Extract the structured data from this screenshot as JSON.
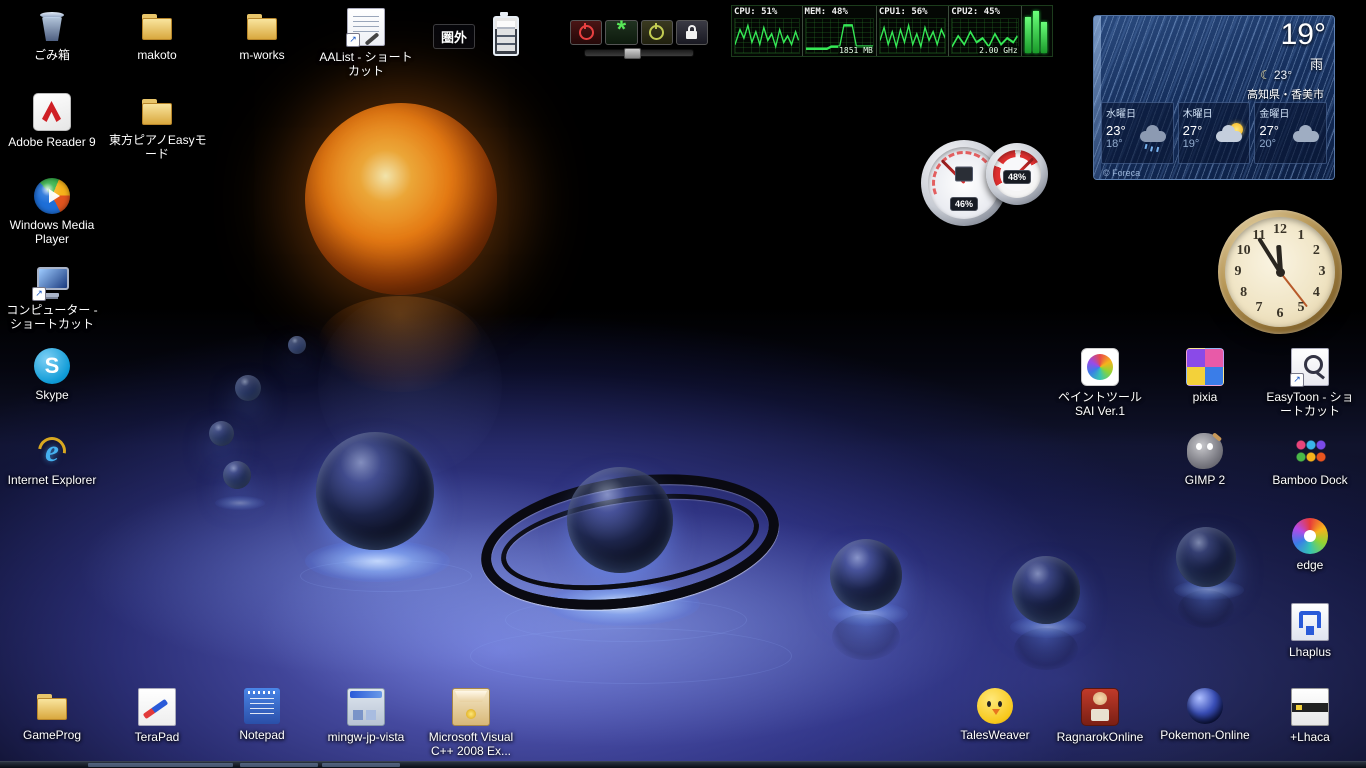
{
  "colors": {
    "floor_glow": "#6a70e0",
    "sun_sphere": "#f08a1a",
    "meter_green": "#35e855",
    "weather_blue": "#16305e",
    "icon_label": "#ffffff"
  },
  "desktop_icons": [
    {
      "id": "recycle-bin",
      "kind": "bin",
      "label": [
        "ごみ箱"
      ],
      "col": 0,
      "row": 0
    },
    {
      "id": "makoto-folder",
      "kind": "folder",
      "label": [
        "makoto"
      ],
      "col": 1,
      "row": 0
    },
    {
      "id": "m-works-folder",
      "kind": "folder",
      "label": [
        "m-works"
      ],
      "col": 2,
      "row": 0
    },
    {
      "id": "aalist-shortcut",
      "kind": "memo",
      "label": [
        "AAList - ショート",
        "カット"
      ],
      "col": 3,
      "row": 0,
      "shortcut": true
    },
    {
      "id": "adobe-reader-9",
      "kind": "pdf",
      "label": [
        "Adobe Reader 9"
      ],
      "col": 0,
      "row": 1
    },
    {
      "id": "touhou-piano-easy-folder",
      "kind": "folder",
      "label": [
        "東方ピアノEasyモ",
        "ード"
      ],
      "col": 1,
      "row": 1
    },
    {
      "id": "windows-media-player",
      "kind": "wmp",
      "label": [
        "Windows Media",
        "Player"
      ],
      "col": 0,
      "row": 2
    },
    {
      "id": "computer-shortcut",
      "kind": "computer",
      "label": [
        "コンピューター -",
        "ショートカット"
      ],
      "col": 0,
      "row": 3,
      "shortcut": true
    },
    {
      "id": "skype",
      "kind": "skype",
      "glyph": "S",
      "label": [
        "Skype"
      ],
      "col": 0,
      "row": 4
    },
    {
      "id": "internet-explorer",
      "kind": "ie",
      "glyph": "e",
      "label": [
        "Internet Explorer"
      ],
      "col": 0,
      "row": 5
    },
    {
      "id": "paint-tool-sai",
      "kind": "sai",
      "label": [
        "ペイントツール",
        "SAI Ver.1"
      ],
      "col": 10,
      "row": 4
    },
    {
      "id": "pixia",
      "kind": "pixia",
      "label": [
        "pixia"
      ],
      "col": 11,
      "row": 4
    },
    {
      "id": "easytoon-shortcut",
      "kind": "easytoon",
      "label": [
        "EasyToon - ショ",
        "ートカット"
      ],
      "col": 12,
      "row": 4,
      "shortcut": true
    },
    {
      "id": "gimp-2",
      "kind": "gimp",
      "label": [
        "GIMP 2"
      ],
      "col": 11,
      "row": 5
    },
    {
      "id": "bamboo-dock",
      "kind": "bamboo",
      "label": [
        "Bamboo Dock"
      ],
      "col": 12,
      "row": 5
    },
    {
      "id": "edge",
      "kind": "edge",
      "label": [
        "edge"
      ],
      "col": 12,
      "row": 6
    },
    {
      "id": "lhaplus",
      "kind": "lhaplus",
      "label": [
        "Lhaplus"
      ],
      "col": 12,
      "row": 7
    },
    {
      "id": "gameprog-folder",
      "kind": "folder",
      "label": [
        "GameProg"
      ],
      "col": 0,
      "row": 8
    },
    {
      "id": "terapad",
      "kind": "terapad",
      "label": [
        "TeraPad"
      ],
      "col": 1,
      "row": 8
    },
    {
      "id": "notepad",
      "kind": "notepad",
      "label": [
        "Notepad"
      ],
      "col": 2,
      "row": 8
    },
    {
      "id": "mingw-jp-vista",
      "kind": "mingw",
      "label": [
        "mingw-jp-vista"
      ],
      "col": 3,
      "row": 8
    },
    {
      "id": "msvc-2008-express",
      "kind": "msvc",
      "label": [
        "Microsoft Visual",
        "C++ 2008 Ex..."
      ],
      "col": 4,
      "row": 8
    },
    {
      "id": "talesweaver",
      "kind": "tales",
      "label": [
        "TalesWeaver"
      ],
      "col": 9,
      "row": 8
    },
    {
      "id": "ragnarok-online",
      "kind": "ragnarok",
      "label": [
        "RagnarokOnline"
      ],
      "col": 10,
      "row": 8
    },
    {
      "id": "pokemon-online",
      "kind": "pokemon",
      "label": [
        "Pokemon-Online"
      ],
      "col": 11,
      "row": 8
    },
    {
      "id": "plus-lhaca",
      "kind": "lhaca",
      "label": [
        "+Lhaca"
      ],
      "col": 12,
      "row": 8
    }
  ],
  "widgets": {
    "signal": {
      "label": "圏外"
    },
    "system_meter": {
      "sections": [
        {
          "label": "CPU: 51%"
        },
        {
          "label": "MEM: 48%",
          "sub": "1851 MB"
        },
        {
          "label": "CPU1: 56%"
        },
        {
          "label": "CPU2: 45%",
          "sub": "2.00 GHz"
        }
      ]
    },
    "gauges": {
      "cpu_percent": "46%",
      "ram_percent": "48%"
    },
    "weather": {
      "current_temp": "19°",
      "condition": "雨",
      "tonight_temp": "23°",
      "location": "高知県・香美市",
      "forecast": [
        {
          "day": "水曜日",
          "high": "23°",
          "low": "18°",
          "icon": "rain"
        },
        {
          "day": "木曜日",
          "high": "27°",
          "low": "19°",
          "icon": "partly-sunny"
        },
        {
          "day": "金曜日",
          "high": "27°",
          "low": "20°",
          "icon": "cloudy"
        }
      ],
      "credit": "© Foreca"
    },
    "clock": {
      "numbers": [
        "12",
        "1",
        "2",
        "3",
        "4",
        "5",
        "6",
        "7",
        "8",
        "9",
        "10",
        "11"
      ],
      "hands": {
        "hour_deg": -4,
        "minute_deg": -32,
        "second_deg": 142
      }
    }
  }
}
